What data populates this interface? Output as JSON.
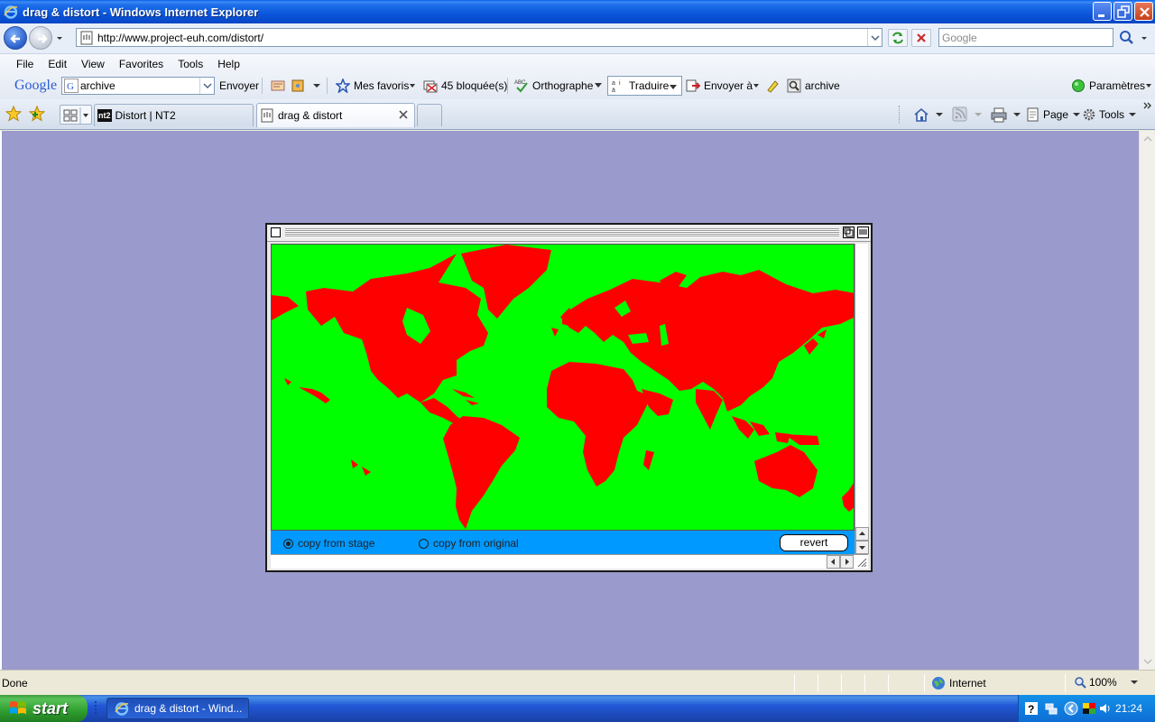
{
  "window": {
    "title": "drag & distort - Windows Internet Explorer"
  },
  "address_bar": {
    "url": "http://www.project-euh.com/distort/",
    "search_placeholder": "Google"
  },
  "menu": [
    "File",
    "Edit",
    "View",
    "Favorites",
    "Tools",
    "Help"
  ],
  "google_toolbar": {
    "logo": "Google",
    "search_value": "archive",
    "send_label": "Envoyer",
    "bookmarks_label": "Mes favoris",
    "blocked_label": "45 bloquée(s)",
    "spell_label": "Orthographe",
    "translate_label": "Traduire",
    "send_to_label": "Envoyer à",
    "archive_label": "archive",
    "settings_label": "Paramètres"
  },
  "tabs": [
    {
      "label": "Distort | NT2",
      "active": false,
      "icon_text": "nt2"
    },
    {
      "label": "drag & distort",
      "active": true
    }
  ],
  "command_bar": {
    "page_label": "Page",
    "tools_label": "Tools"
  },
  "app": {
    "option_stage": "copy from stage",
    "option_original": "copy from original",
    "selected_option": "copy from stage",
    "revert_label": "revert",
    "colors": {
      "stage_bg": "#00FF00",
      "land": "#FF0000",
      "control_bar": "#0099FF",
      "page_bg": "#9A9ACC"
    }
  },
  "status_bar": {
    "status_text": "Done",
    "zone_label": "Internet",
    "zoom_label": "100%"
  },
  "taskbar": {
    "start_label": "start",
    "task_label": "drag & distort - Wind...",
    "clock": "21:24"
  }
}
